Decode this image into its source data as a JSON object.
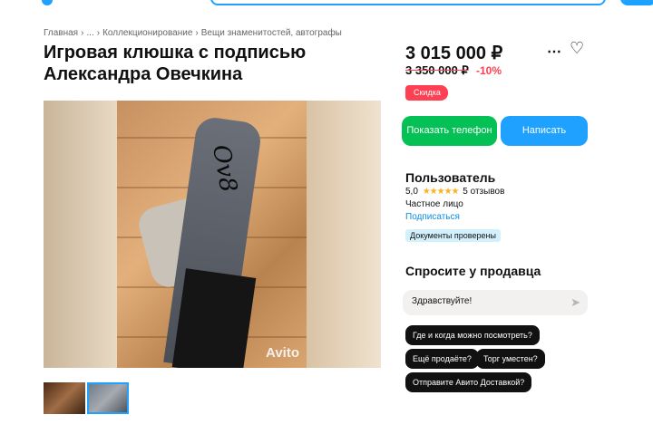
{
  "breadcrumbs": [
    "Главная",
    "›",
    "...",
    "›",
    "Коллекционирование",
    "›",
    "Вещи знаменитостей, автографы"
  ],
  "title": "Игровая клюшка с подписью Александра Овечкина",
  "price": {
    "current": "3 015 000 ₽",
    "old": "3 350 000 ₽",
    "discount": "-10%",
    "badge": "Скидка"
  },
  "actions": {
    "phone": "Показать телефон",
    "message": "Написать"
  },
  "seller": {
    "name": "Пользователь",
    "rating": "5,0",
    "stars": "★★★★★",
    "reviews": "5 отзывов",
    "type": "Частное лицо",
    "subscribe": "Подписаться",
    "docs": "Документы проверены"
  },
  "ask": {
    "title": "Спросите у продавца",
    "input_value": "Здравствуйте!",
    "chips": [
      "Где и когда можно посмотреть?",
      "Ещё продаёте?",
      "Торг уместен?",
      "Отправите Авито Доставкой?"
    ]
  },
  "gallery": {
    "watermark": "Avito",
    "signature": "Ov8"
  },
  "icons": {
    "more": "⋯",
    "heart": "♡",
    "send": "➤"
  },
  "colors": {
    "green": "#04c156",
    "blue": "#1ea1ff",
    "red": "#ff4053"
  }
}
